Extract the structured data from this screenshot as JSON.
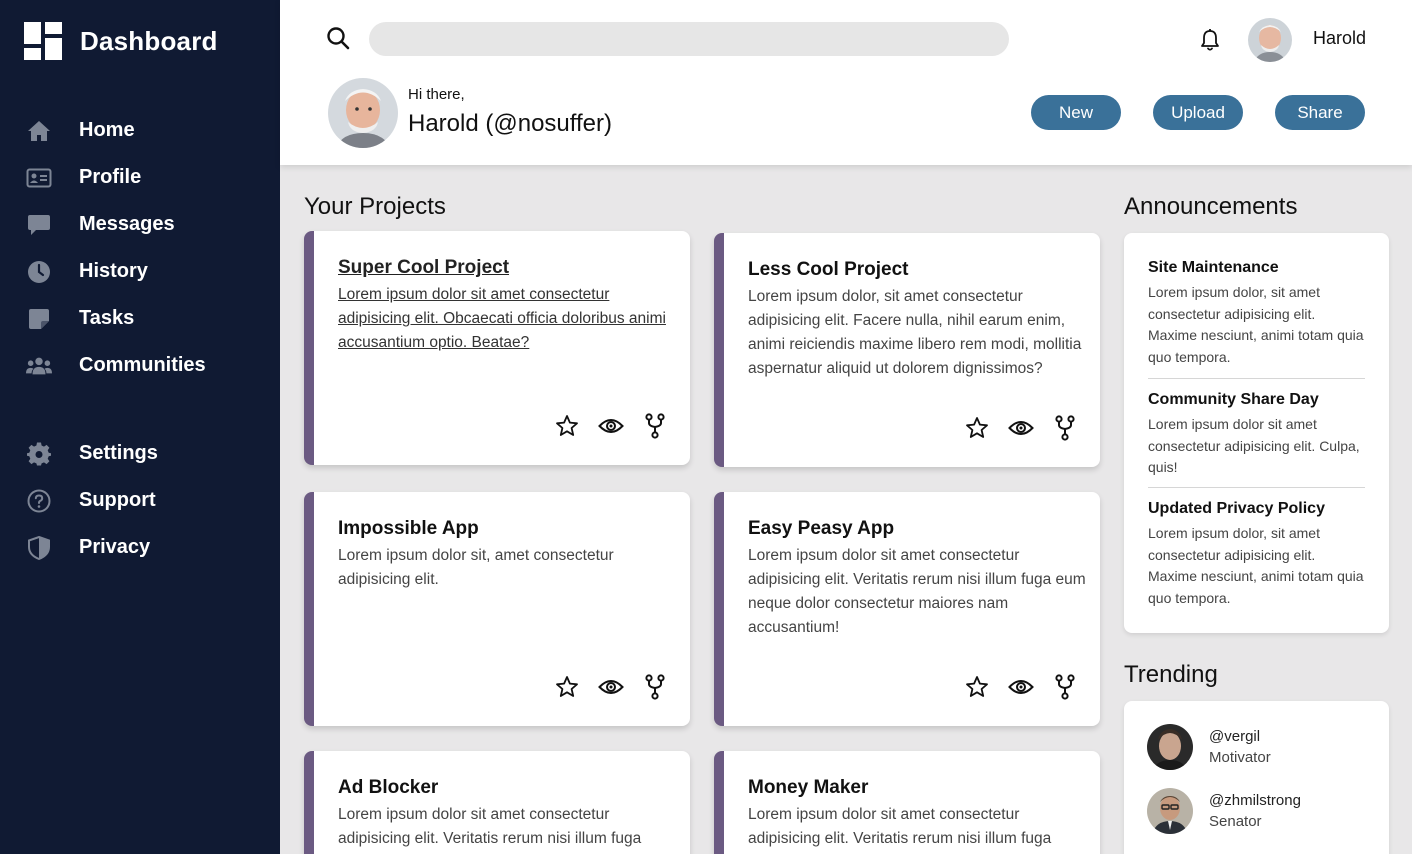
{
  "brand": {
    "title": "Dashboard",
    "icon": "dashboard-logo-icon"
  },
  "sidebar": {
    "items": [
      {
        "label": "Home",
        "icon": "home-icon"
      },
      {
        "label": "Profile",
        "icon": "id-card-icon"
      },
      {
        "label": "Messages",
        "icon": "chat-icon"
      },
      {
        "label": "History",
        "icon": "clock-icon"
      },
      {
        "label": "Tasks",
        "icon": "note-icon"
      },
      {
        "label": "Communities",
        "icon": "people-icon"
      }
    ],
    "secondary": [
      {
        "label": "Settings",
        "icon": "gear-icon"
      },
      {
        "label": "Support",
        "icon": "help-circle-icon"
      },
      {
        "label": "Privacy",
        "icon": "shield-icon"
      }
    ]
  },
  "header": {
    "search": {
      "placeholder": "",
      "value": ""
    },
    "user_name": "Harold",
    "greeting": "Hi there,",
    "full_name": "Harold (@nosuffer)",
    "buttons": {
      "new": "New",
      "upload": "Upload",
      "share": "Share"
    }
  },
  "projects": {
    "title": "Your Projects",
    "items": [
      {
        "title": "Super Cool Project",
        "text": "Lorem ipsum dolor sit amet consectetur adipisicing elit. Obcaecati officia doloribus animi accusantium optio. Beatae?"
      },
      {
        "title": "Less Cool Project",
        "text": "Lorem ipsum dolor, sit amet consectetur adipisicing elit. Facere nulla, nihil earum enim, animi reiciendis maxime libero rem modi, mollitia aspernatur aliquid ut dolorem dignissimos?"
      },
      {
        "title": "Impossible App",
        "text": "Lorem ipsum dolor sit, amet consectetur adipisicing elit."
      },
      {
        "title": "Easy Peasy App",
        "text": "Lorem ipsum dolor sit amet consectetur adipisicing elit. Veritatis rerum nisi illum fuga eum neque dolor consectetur maiores nam accusantium!"
      },
      {
        "title": "Ad Blocker",
        "text": "Lorem ipsum dolor sit amet consectetur adipisicing elit. Veritatis rerum nisi illum fuga"
      },
      {
        "title": "Money Maker",
        "text": "Lorem ipsum dolor sit amet consectetur adipisicing elit. Veritatis rerum nisi illum fuga"
      }
    ],
    "action_icons": [
      "star-icon",
      "eye-icon",
      "fork-icon"
    ]
  },
  "announcements": {
    "title": "Announcements",
    "items": [
      {
        "title": "Site Maintenance",
        "text": "Lorem ipsum dolor, sit amet consectetur adipisicing elit. Maxime nesciunt, animi totam quia quo tempora."
      },
      {
        "title": "Community Share Day",
        "text": "Lorem ipsum dolor sit amet consectetur adipisicing elit. Culpa, quis!"
      },
      {
        "title": "Updated Privacy Policy",
        "text": "Lorem ipsum dolor, sit amet consectetur adipisicing elit. Maxime nesciunt, animi totam quia quo tempora."
      }
    ]
  },
  "trending": {
    "title": "Trending",
    "items": [
      {
        "handle": "@vergil",
        "role": "Motivator"
      },
      {
        "handle": "@zhmilstrong",
        "role": "Senator"
      }
    ]
  },
  "colors": {
    "sidebar_bg": "#101a33",
    "accent_button": "#3a7199",
    "card_stripe": "#6b5a82",
    "page_bg": "#e8e7e8"
  }
}
